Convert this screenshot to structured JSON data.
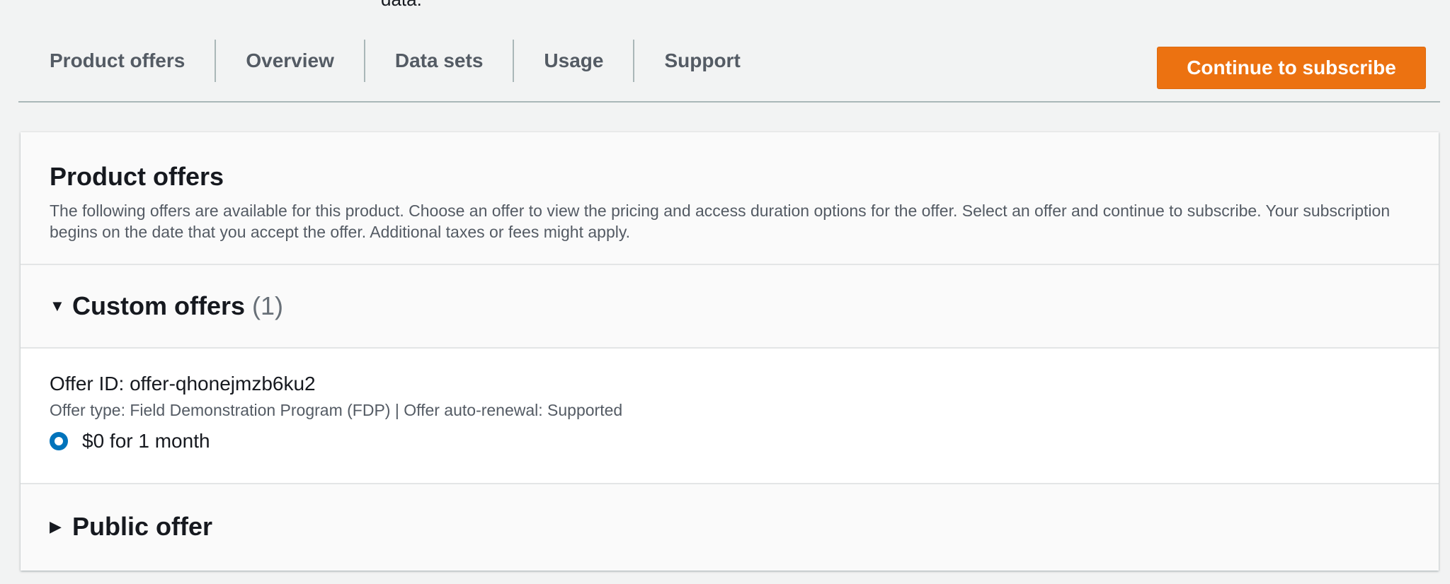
{
  "top_fragment": "data.",
  "tabs": [
    {
      "label": "Product offers"
    },
    {
      "label": "Overview"
    },
    {
      "label": "Data sets"
    },
    {
      "label": "Usage"
    },
    {
      "label": "Support"
    }
  ],
  "subscribe_button": "Continue to subscribe",
  "panel": {
    "title": "Product offers",
    "description": "The following offers are available for this product. Choose an offer to view the pricing and access duration options for the offer. Select an offer and continue to subscribe. Your subscription begins on the date that you accept the offer. Additional taxes or fees might apply."
  },
  "custom_offers": {
    "title": "Custom offers",
    "count": "(1)",
    "offer": {
      "id_text": "Offer ID: offer-qhonejmzb6ku2",
      "meta_text": "Offer type: Field Demonstration Program (FDP) | Offer auto-renewal: Supported",
      "option_label": "$0 for 1 month",
      "option_selected": true
    }
  },
  "public_offer": {
    "title": "Public offer"
  },
  "colors": {
    "accent_orange": "#ec7211",
    "radio_blue": "#0073bb",
    "background": "#f2f3f3"
  },
  "icons": {
    "expanded": "caret-down-icon",
    "collapsed": "caret-right-icon"
  }
}
